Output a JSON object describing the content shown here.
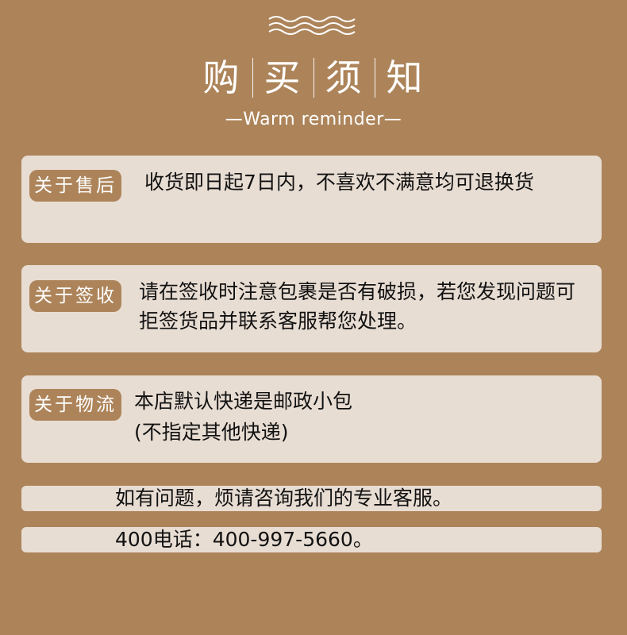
{
  "header": {
    "title_chars": [
      "购",
      "买",
      "须",
      "知"
    ],
    "subtitle": "—Warm reminder—"
  },
  "sections": [
    {
      "tag": "关于售后",
      "text": "收货即日起7日内，不喜欢不满意均可退换货"
    },
    {
      "tag": "关于签收",
      "text": "请在签收时注意包裹是否有破损，若您发现问题可拒签货品并联系客服帮您处理。"
    },
    {
      "tag": "关于物流",
      "line1": "本店默认快递是邮政小包",
      "line2": "(不指定其他快递)"
    }
  ],
  "footer": {
    "contact_line": "如有问题，烦请咨询我们的专业客服。",
    "phone_line": "400电话：400-997-5660。"
  },
  "colors": {
    "background": "#ad845a",
    "card": "#e8ddd3",
    "text": "#111111",
    "accent": "#ffffff"
  }
}
